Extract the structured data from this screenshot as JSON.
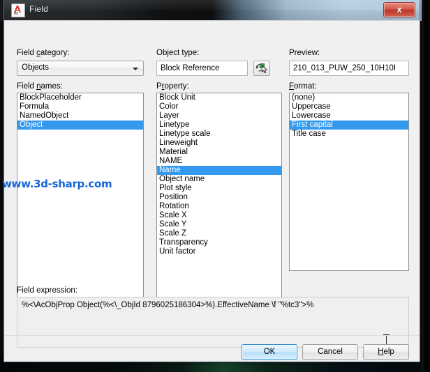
{
  "window": {
    "title": "Field",
    "icon": "autocad-field-icon",
    "close_label": "x"
  },
  "watermark": "www.3d-sharp.com",
  "left": {
    "field_category_label": "Field category:",
    "field_category_mnemonic": "c",
    "field_category_value": "Objects",
    "field_names_label": "Field names:",
    "field_names_mnemonic": "n",
    "field_names": [
      "BlockPlaceholder",
      "Formula",
      "NamedObject",
      "Object"
    ],
    "field_names_selected": "Object"
  },
  "middle": {
    "object_type_label": "Object type:",
    "object_type_value": "Block Reference",
    "select_object_button": "select-object-icon",
    "property_label": "Property:",
    "property_mnemonic": "r",
    "properties": [
      "Block Unit",
      "Color",
      "Layer",
      "Linetype",
      "Linetype scale",
      "Lineweight",
      "Material",
      "NAME",
      "Name",
      "Object name",
      "Plot style",
      "Position",
      "Rotation",
      "Scale X",
      "Scale Y",
      "Scale Z",
      "Transparency",
      "Unit factor"
    ],
    "property_selected": "Name"
  },
  "right": {
    "preview_label": "Preview:",
    "preview_value": "210_013_PUW_250_10H10I",
    "format_label": "Format:",
    "format_mnemonic": "F",
    "formats": [
      "(none)",
      "Uppercase",
      "Lowercase",
      "First capital",
      "Title case"
    ],
    "format_selected": "First capital"
  },
  "expression": {
    "label": "Field expression:",
    "value": "%<\\AcObjProp Object(%<\\_ObjId 8796025186304>%).EffectiveName \\f \"%tc3\">%"
  },
  "buttons": {
    "ok": "OK",
    "cancel": "Cancel",
    "help": "Help",
    "help_mnemonic": "H"
  },
  "colors": {
    "selection": "#3399ee",
    "watermark": "#1565d8",
    "close_button": "#bc3527",
    "default_button_border": "#2e8ccf"
  }
}
